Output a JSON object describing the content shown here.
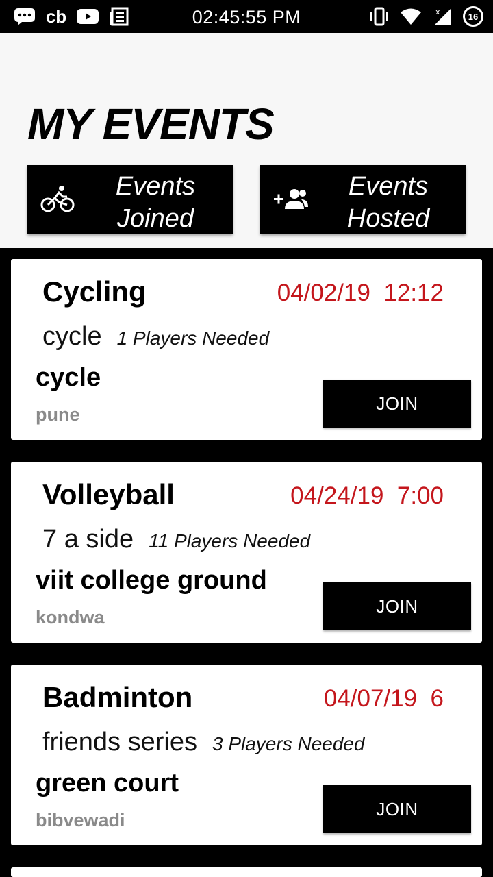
{
  "status_bar": {
    "time": "02:45:55 PM",
    "left_icons": [
      "chat-bubble-icon",
      "cb-logo",
      "youtube-icon",
      "news-icon"
    ],
    "cb_text": "cb",
    "right_icons": [
      "vibrate-icon",
      "wifi-icon",
      "signal-icon",
      "battery-icon"
    ],
    "battery_level": "16"
  },
  "header": {
    "title": "MY EVENTS",
    "tabs": [
      {
        "label_line1": "Events",
        "label_line2": "Joined",
        "icon": "bicycle-icon"
      },
      {
        "label_line1": "Events",
        "label_line2": "Hosted",
        "icon": "add-group-icon"
      }
    ]
  },
  "events": [
    {
      "sport": "Cycling",
      "date": "04/02/19",
      "time": "12:12",
      "name": "cycle",
      "players_needed": "1 Players Needed",
      "venue": "cycle",
      "area": "pune",
      "join_label": "JOIN"
    },
    {
      "sport": "Volleyball",
      "date": "04/24/19",
      "time": "7:00",
      "name": "7 a side",
      "players_needed": "11 Players Needed",
      "venue": "viit college ground",
      "area": "kondwa",
      "join_label": "JOIN"
    },
    {
      "sport": "Badminton",
      "date": "04/07/19",
      "time": "6",
      "name": "friends series",
      "players_needed": "3 Players Needed",
      "venue": "green court",
      "area": "bibvewadi",
      "join_label": "JOIN"
    }
  ],
  "colors": {
    "accent_red": "#c4161c",
    "area_gray": "#8a8a8a",
    "header_bg": "#f7f7f7"
  }
}
